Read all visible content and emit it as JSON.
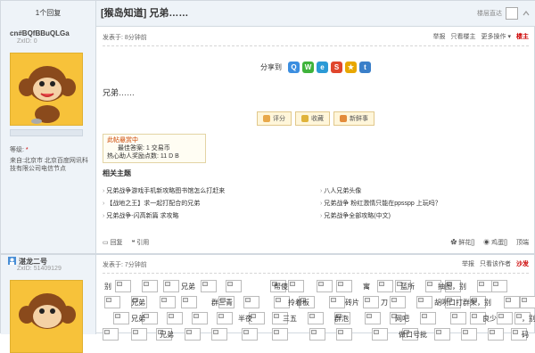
{
  "header": {
    "reply_count": "1个回复",
    "title": "[猴岛知道] 兄弟……",
    "nav": "楼层直达"
  },
  "post1": {
    "user": {
      "name": "cn#BQfBBuQLGa",
      "id_label": "ZxID:",
      "id_value": "0",
      "level_label": "等级:",
      "level_value": "*",
      "location": "来自:北京市 北京百度网讯科技有限公司电信节点"
    },
    "time": "发表于: 8分钟前",
    "actions": [
      "举报",
      "只看楼主",
      "更多操作 ▾"
    ],
    "floor": "楼主",
    "share_label": "分享到",
    "share_icons": [
      {
        "name": "qq-icon",
        "color": "#3b8ee0",
        "glyph": "Q"
      },
      {
        "name": "wechat-icon",
        "color": "#3fb33b",
        "glyph": "W"
      },
      {
        "name": "qzone-icon",
        "color": "#2b9ad6",
        "glyph": "e"
      },
      {
        "name": "weibo-icon",
        "color": "#e0462d",
        "glyph": "S"
      },
      {
        "name": "star-icon",
        "color": "#e8a700",
        "glyph": "★"
      },
      {
        "name": "tencent-weibo-icon",
        "color": "#3a7fc9",
        "glyph": "t"
      }
    ],
    "body": "兄弟……",
    "buttons": [
      "评分",
      "收藏",
      "新鲜事"
    ],
    "rate_box": {
      "title": "此帖悬赏中",
      "line1": "最佳答案: 1 交易币",
      "line2": "热心助人奖励点数: 11 D B"
    },
    "related_title": "相关主题",
    "related": [
      "兄弟战争游戏手机新攻略图书馆怎么打赶来",
      "八人兄弟头像",
      "【战地之王】求一起打配合的兄弟",
      "兄弟战争 粉红激情只能在ppsspp 上玩吗？",
      "兄弟战争-闪高新篇 求攻略",
      "兄弟战争全部攻略(中文)"
    ],
    "bottom_left": [
      "回复",
      "引用"
    ],
    "bottom_right": [
      "鲜花[]",
      "鸡蛋[]",
      "顶端"
    ]
  },
  "post2": {
    "user": {
      "name": "湛龙二号",
      "id_label": "ZxID:",
      "id_value": "51409129"
    },
    "time": "发表于: 7分钟前",
    "actions": [
      "举报",
      "只看该作者"
    ],
    "floor": "沙发",
    "words": [
      "别",
      "兄弟",
      "帮傻",
      "寓",
      "蓝所",
      "抽图，别",
      "兄弟",
      "群三青",
      "拎着板",
      "砖片",
      "刀",
      "胡咧口打群架，别",
      "兄弟",
      "半夜",
      "三五",
      "群泡",
      "网吧",
      "良少",
      "，别",
      "兄弟",
      "做口号批",
      "码"
    ]
  }
}
